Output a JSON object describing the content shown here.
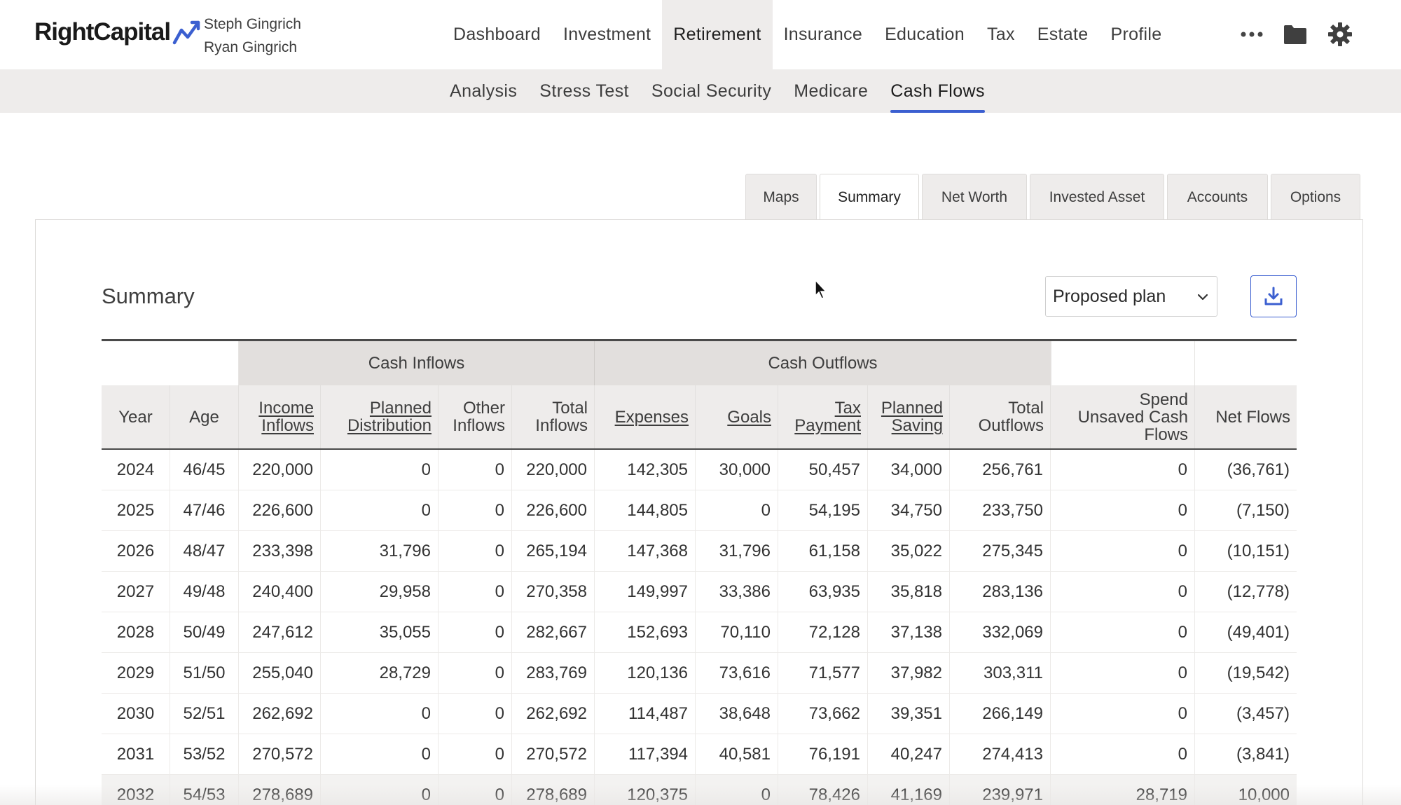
{
  "brand": {
    "name": "RightCapital"
  },
  "clients": {
    "primary": "Steph Gingrich",
    "secondary": "Ryan Gingrich"
  },
  "main_nav": [
    {
      "label": "Dashboard"
    },
    {
      "label": "Investment"
    },
    {
      "label": "Retirement",
      "active": true
    },
    {
      "label": "Insurance"
    },
    {
      "label": "Education"
    },
    {
      "label": "Tax"
    },
    {
      "label": "Estate"
    },
    {
      "label": "Profile"
    }
  ],
  "nav_icons": [
    "more-dots-icon",
    "folder-icon",
    "gear-icon"
  ],
  "sub_nav": [
    {
      "label": "Analysis"
    },
    {
      "label": "Stress Test"
    },
    {
      "label": "Social Security"
    },
    {
      "label": "Medicare"
    },
    {
      "label": "Cash Flows",
      "active": true
    }
  ],
  "tabs": [
    {
      "label": "Maps"
    },
    {
      "label": "Summary",
      "active": true
    },
    {
      "label": "Net Worth"
    },
    {
      "label": "Invested Asset"
    },
    {
      "label": "Accounts"
    },
    {
      "label": "Options"
    }
  ],
  "panel": {
    "title": "Summary",
    "plan_select": {
      "value": "Proposed plan"
    },
    "download_icon": "download-icon"
  },
  "colors": {
    "accent": "#3b5fd0",
    "header_bg": "#eeeceb",
    "group_bg": "#e2dfdd"
  },
  "table": {
    "groups": {
      "inflows": "Cash Inflows",
      "outflows": "Cash Outflows"
    },
    "headers": [
      {
        "line1": "Year",
        "line2": ""
      },
      {
        "line1": "Age",
        "line2": ""
      },
      {
        "line1": "Income",
        "line2": "Inflows",
        "link": true
      },
      {
        "line1": "Planned",
        "line2": "Distribution",
        "link": true
      },
      {
        "line1": "Other",
        "line2": "Inflows"
      },
      {
        "line1": "Total",
        "line2": "Inflows"
      },
      {
        "line1": "Expenses",
        "line2": "",
        "link": true
      },
      {
        "line1": "Goals",
        "line2": "",
        "link": true
      },
      {
        "line1": "Tax",
        "line2": "Payment",
        "link": true
      },
      {
        "line1": "Planned",
        "line2": "Saving",
        "link": true
      },
      {
        "line1": "Total",
        "line2": "Outflows"
      },
      {
        "line1": "Spend",
        "line2": "Unsaved Cash",
        "line3": "Flows"
      },
      {
        "line1": "Net Flows",
        "line2": ""
      }
    ],
    "rows": [
      [
        "2024",
        "46/45",
        "220,000",
        "0",
        "0",
        "220,000",
        "142,305",
        "30,000",
        "50,457",
        "34,000",
        "256,761",
        "0",
        "(36,761)"
      ],
      [
        "2025",
        "47/46",
        "226,600",
        "0",
        "0",
        "226,600",
        "144,805",
        "0",
        "54,195",
        "34,750",
        "233,750",
        "0",
        "(7,150)"
      ],
      [
        "2026",
        "48/47",
        "233,398",
        "31,796",
        "0",
        "265,194",
        "147,368",
        "31,796",
        "61,158",
        "35,022",
        "275,345",
        "0",
        "(10,151)"
      ],
      [
        "2027",
        "49/48",
        "240,400",
        "29,958",
        "0",
        "270,358",
        "149,997",
        "33,386",
        "63,935",
        "35,818",
        "283,136",
        "0",
        "(12,778)"
      ],
      [
        "2028",
        "50/49",
        "247,612",
        "35,055",
        "0",
        "282,667",
        "152,693",
        "70,110",
        "72,128",
        "37,138",
        "332,069",
        "0",
        "(49,401)"
      ],
      [
        "2029",
        "51/50",
        "255,040",
        "28,729",
        "0",
        "283,769",
        "120,136",
        "73,616",
        "71,577",
        "37,982",
        "303,311",
        "0",
        "(19,542)"
      ],
      [
        "2030",
        "52/51",
        "262,692",
        "0",
        "0",
        "262,692",
        "114,487",
        "38,648",
        "73,662",
        "39,351",
        "266,149",
        "0",
        "(3,457)"
      ],
      [
        "2031",
        "53/52",
        "270,572",
        "0",
        "0",
        "270,572",
        "117,394",
        "40,581",
        "76,191",
        "40,247",
        "274,413",
        "0",
        "(3,841)"
      ],
      [
        "2032",
        "54/53",
        "278,689",
        "0",
        "0",
        "278,689",
        "120,375",
        "0",
        "78,426",
        "41,169",
        "239,971",
        "28,719",
        "10,000"
      ]
    ]
  }
}
